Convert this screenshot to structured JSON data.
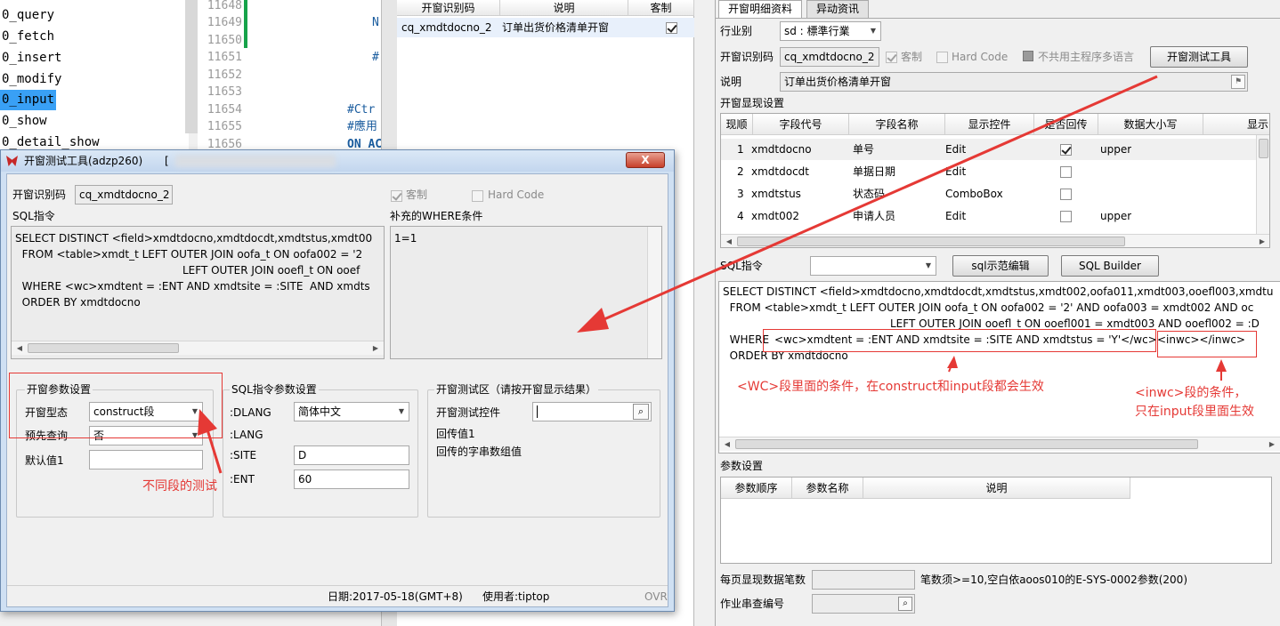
{
  "code_editor": {
    "left_items": [
      "0_query",
      "0_fetch",
      "0_insert",
      "0_modify",
      "0_input",
      "0_show",
      "0_detail_show"
    ],
    "selected_item": "0_input",
    "line_numbers": [
      "11648",
      "11649",
      "11650",
      "11651",
      "11652",
      "11653",
      "11654",
      "11655",
      "11656"
    ],
    "snippets": {
      "n1": "N",
      "n2": "#",
      "n3": "#Ctr",
      "n4": "#應用",
      "n5": "ON AC"
    }
  },
  "mid_list": {
    "headers": [
      "开窗识别码",
      "说明",
      "客制"
    ],
    "rows": [
      {
        "code": "cq_xmdtdocno_2",
        "desc": "订单出货价格清单开窗",
        "custom": true
      }
    ]
  },
  "right": {
    "tabs": [
      "开窗明细资料",
      "异动资讯"
    ],
    "industry_label": "行业别",
    "industry_value": "sd : 標準行業",
    "window_id_label": "开窗识别码",
    "window_id_value": "cq_xmdtdocno_2",
    "custom_label": "客制",
    "hardcode_label": "Hard Code",
    "no_share_label": "不共用主程序多语言",
    "test_tool_button": "开窗测试工具",
    "desc_label": "说明",
    "desc_value": "订单出货价格清单开窗",
    "display_settings_label": "开窗显现设置",
    "grid_headers": [
      "现顺",
      "字段代号",
      "字段名称",
      "显示控件",
      "是否回传",
      "数据大小写",
      "显示"
    ],
    "grid_rows": [
      {
        "seq": "1",
        "code": "xmdtdocno",
        "name": "单号",
        "ctrl": "Edit",
        "ret": true,
        "case": "upper"
      },
      {
        "seq": "2",
        "code": "xmdtdocdt",
        "name": "单据日期",
        "ctrl": "Edit",
        "ret": false,
        "case": ""
      },
      {
        "seq": "3",
        "code": "xmdtstus",
        "name": "状态码",
        "ctrl": "ComboBox",
        "ret": false,
        "case": ""
      },
      {
        "seq": "4",
        "code": "xmdt002",
        "name": "申请人员",
        "ctrl": "Edit",
        "ret": false,
        "case": "upper"
      }
    ],
    "sql_label": "SQL指令",
    "sql_sample_button": "sql示范编辑",
    "sql_builder_button": "SQL Builder",
    "sql_text": {
      "l1": "SELECT DISTINCT <field>xmdtdocno,xmdtdocdt,xmdtstus,xmdt002,oofa011,xmdt003,ooefl003,xmdtu",
      "l2": "  FROM <table>xmdt_t LEFT OUTER JOIN oofa_t ON oofa002 = '2' AND oofa003 = xmdt002 AND oc",
      "l3": "LEFT OUTER JOIN ooefl_t ON ooefl001 = xmdt003 AND ooefl002 = :D",
      "l4a": "  WHERE ",
      "l4b": "<wc>xmdtent = :ENT AND xmdtsite = :SITE  AND xmdtstus = 'Y'</wc>",
      "l4c": "<inwc></inwc>",
      "l5": "  ORDER BY xmdtdocno"
    },
    "annot_wc": "<WC>段里面的条件，在construct和input段都会生效",
    "annot_inwc_1": "<inwc>段的条件，",
    "annot_inwc_2": "只在input段里面生效",
    "param_settings_label": "参数设置",
    "param_headers": [
      "参数顺序",
      "参数名称",
      "说明"
    ],
    "per_page_label": "每页显现数据笔数",
    "per_page_hint": "笔数须>=10,空白依aoos010的E-SYS-0002参数(200)",
    "job_query_label": "作业串查编号"
  },
  "dialog": {
    "title": "开窗测试工具(adzp260)",
    "title_extra": "[",
    "close_label": "X",
    "window_id_label": "开窗识别码",
    "window_id_value": "cq_xmdtdocno_2",
    "custom_label": "客制",
    "hardcode_label": "Hard Code",
    "sql_label": "SQL指令",
    "where_label": "补充的WHERE条件",
    "sql_text": {
      "l1": "SELECT DISTINCT <field>xmdtdocno,xmdtdocdt,xmdtstus,xmdt00",
      "l2": "  FROM <table>xmdt_t LEFT OUTER JOIN oofa_t ON oofa002 = '2",
      "l3": "LEFT OUTER JOIN ooefl_t ON ooef",
      "l4": "  WHERE <wc>xmdtent = :ENT AND xmdtsite = :SITE  AND xmdts",
      "l5": "  ORDER BY xmdtdocno"
    },
    "where_text": "1=1",
    "param_group": "开窗参数设置",
    "mode_label": "开窗型态",
    "mode_value": "construct段",
    "prequery_label": "预先查询",
    "prequery_value": "否",
    "default_label": "默认值1",
    "sqlparam_group": "SQL指令参数设置",
    "dlang_label": ":DLANG",
    "dlang_value": "简体中文",
    "lang_label": ":LANG",
    "site_label": ":SITE",
    "site_value": "D",
    "ent_label": ":ENT",
    "ent_value": "60",
    "test_group": "开窗测试区（请按开窗显示结果）",
    "test_ctrl_label": "开窗测试控件",
    "return1_label": "回传值1",
    "return_arr_label": "回传的字串数组值",
    "annot_segment": "不同段的测试",
    "status_date": "日期:2017-05-18(GMT+8)",
    "status_user": "使用者:tiptop",
    "status_ovr": "OVR"
  },
  "colors": {
    "accent_red": "#e53935",
    "selection_blue": "#39a0f5"
  }
}
